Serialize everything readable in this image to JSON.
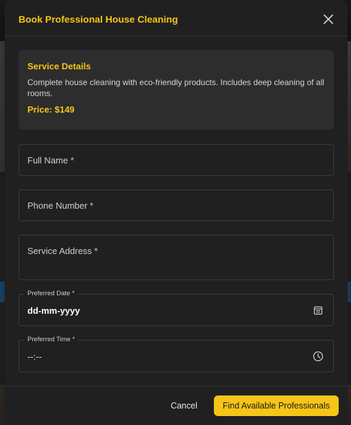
{
  "modal": {
    "title": "Book Professional House Cleaning",
    "close_icon": "close-icon"
  },
  "service": {
    "heading": "Service Details",
    "description": "Complete house cleaning with eco-friendly products. Includes deep cleaning of all rooms.",
    "price": "Price: $149"
  },
  "form": {
    "full_name_placeholder": "Full Name *",
    "phone_placeholder": "Phone Number *",
    "address_placeholder": "Service Address *",
    "date_label": "Preferred Date *",
    "date_value": "dd-mm-yyyy",
    "date_icon": "calendar-icon",
    "time_label": "Preferred Time *",
    "time_value": "--:--",
    "time_icon": "clock-icon"
  },
  "footer": {
    "cancel_label": "Cancel",
    "submit_label": "Find Available Professionals"
  },
  "colors": {
    "accent": "#f5c518",
    "modal_bg": "#202020",
    "card_bg": "#2d2d2d"
  }
}
